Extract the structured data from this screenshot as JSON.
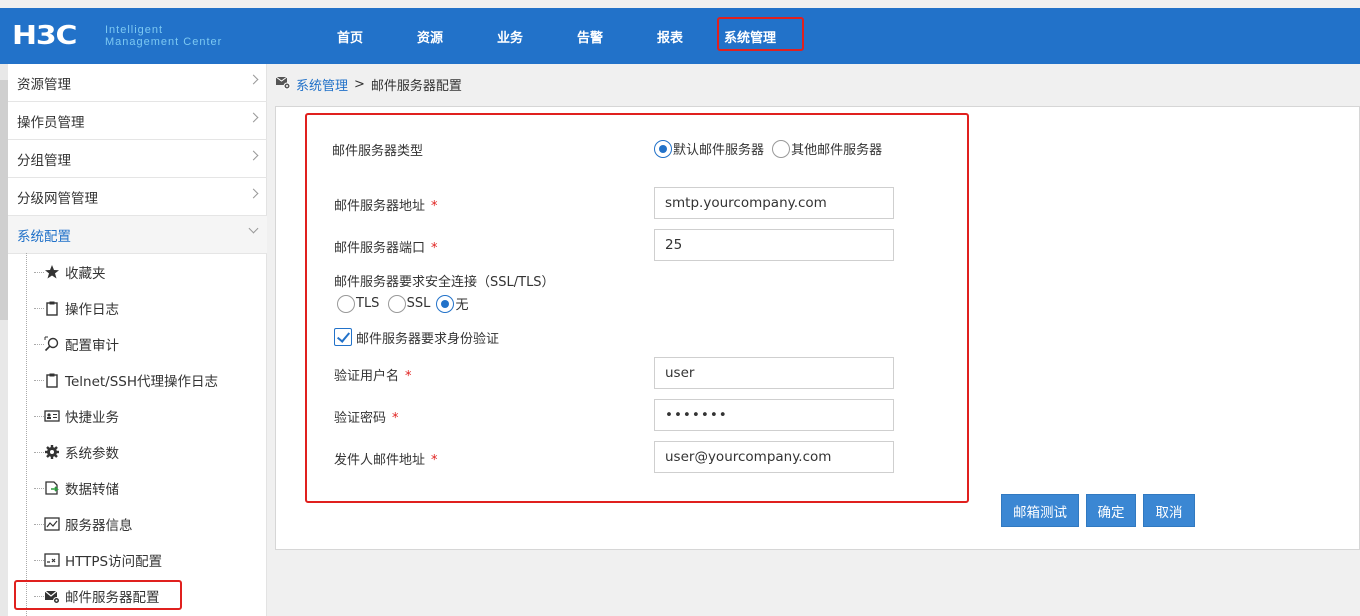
{
  "app": {
    "logo": "H3C",
    "logo_sub_line1": "Intelligent",
    "logo_sub_line2": "Management Center"
  },
  "nav": {
    "items": [
      "首页",
      "资源",
      "业务",
      "告警",
      "报表",
      "系统管理"
    ],
    "active": "系统管理"
  },
  "sidebar": {
    "groups": [
      "资源管理",
      "操作员管理",
      "分组管理",
      "分级网管管理",
      "系统配置"
    ],
    "open_group": "系统配置",
    "sub_items": [
      {
        "label": "收藏夹",
        "icon": "star-icon"
      },
      {
        "label": "操作日志",
        "icon": "clipboard-icon"
      },
      {
        "label": "配置审计",
        "icon": "audit-search-icon"
      },
      {
        "label": "Telnet/SSH代理操作日志",
        "icon": "clipboard-icon"
      },
      {
        "label": "快捷业务",
        "icon": "id-card-icon"
      },
      {
        "label": "系统参数",
        "icon": "gear-icon"
      },
      {
        "label": "数据转储",
        "icon": "data-dump-icon"
      },
      {
        "label": "服务器信息",
        "icon": "server-info-icon"
      },
      {
        "label": "HTTPS访问配置",
        "icon": "https-config-icon"
      },
      {
        "label": "邮件服务器配置",
        "icon": "mail-server-icon"
      }
    ],
    "active_sub": "邮件服务器配置"
  },
  "breadcrumb": {
    "root": "系统管理",
    "separator": ">",
    "current": "邮件服务器配置"
  },
  "form": {
    "server_type_label": "邮件服务器类型",
    "server_type_options": [
      "默认邮件服务器",
      "其他邮件服务器"
    ],
    "server_type_selected": "默认邮件服务器",
    "address_label": "邮件服务器地址",
    "address_value": "smtp.yourcompany.com",
    "port_label": "邮件服务器端口",
    "port_value": "25",
    "secure_label": "邮件服务器要求安全连接（SSL/TLS）",
    "secure_options": [
      "TLS",
      "SSL",
      "无"
    ],
    "secure_selected": "无",
    "auth_label": "邮件服务器要求身份验证",
    "auth_checked": true,
    "username_label": "验证用户名",
    "username_value": "user",
    "password_label": "验证密码",
    "password_value": "•••••••",
    "sender_label": "发件人邮件地址",
    "sender_value": "user@yourcompany.com",
    "required_mark": "*"
  },
  "buttons": {
    "test": "邮箱测试",
    "ok": "确定",
    "cancel": "取消"
  },
  "colors": {
    "header_blue": "#2272c9",
    "button_blue": "#3b87d3",
    "highlight_red": "#e0201e"
  }
}
